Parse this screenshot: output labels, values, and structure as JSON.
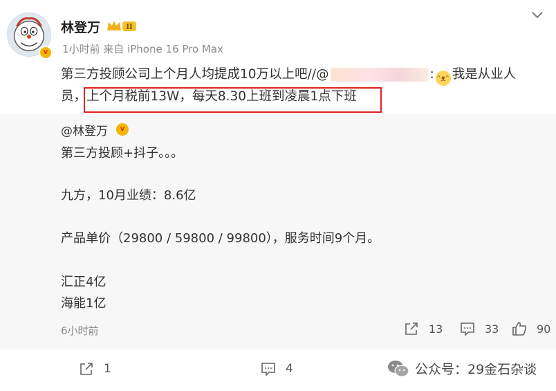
{
  "post": {
    "author": "林登万",
    "meta": "1小时前  来自 iPhone 16 Pro Max",
    "text_part1": "第三方投顾公司上个月人均提成10万以上吧//@",
    "text_part2": ":",
    "text_part3": "我是从业人",
    "text_line2_start": "员，",
    "text_highlight": "上个月税前13W，每天8.30上班到凌晨1点下班",
    "actions": {
      "share": "1",
      "comment": "4"
    }
  },
  "repost": {
    "author": "@林登万",
    "lines": [
      "第三方投顾+抖子。。。",
      "九方，10月业绩：8.6亿",
      "产品单价（29800 / 59800 / 99800），服务时间9个月。",
      "汇正4亿",
      "海能1亿"
    ],
    "time": "6小时前",
    "stats": {
      "share": "13",
      "comment": "33",
      "like": "90"
    }
  },
  "watermark": "公众号：29金石杂谈",
  "badge_text": "II",
  "verified_mark": "v",
  "colors": {
    "highlight_border": "#e0201d",
    "verified": "#f7b500",
    "repost_bg": "#f7f7f7"
  },
  "icons": [
    "avatar",
    "vip-crown-icon",
    "chevron-down-icon",
    "share-icon",
    "comment-icon",
    "like-icon",
    "wechat-icon"
  ]
}
